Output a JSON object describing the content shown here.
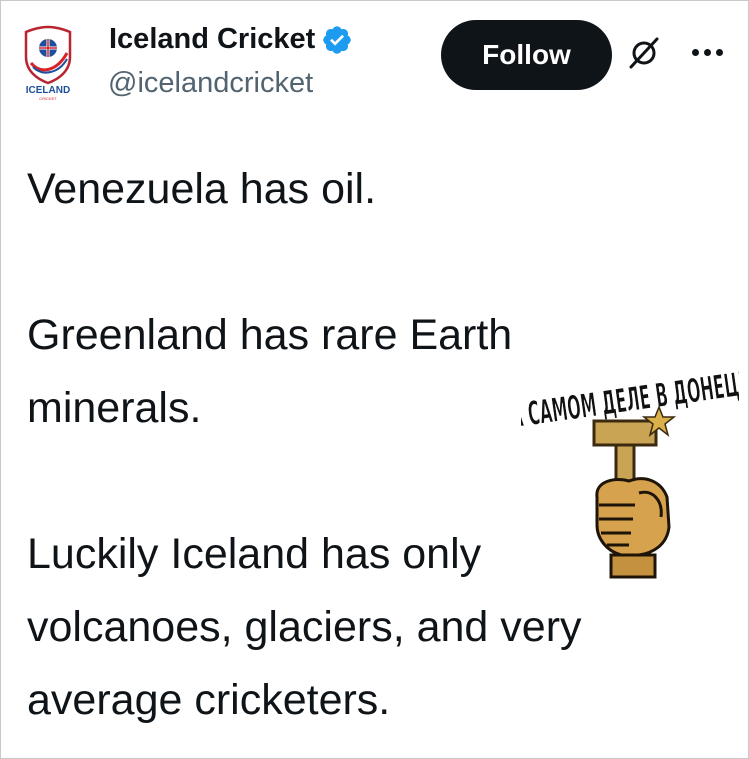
{
  "account": {
    "display_name": "Iceland Cricket",
    "handle": "@icelandcricket",
    "verified": true,
    "avatar_text": "ICELAND",
    "avatar_subtext": "CRICKET"
  },
  "actions": {
    "follow_label": "Follow",
    "grok_icon": "grok-icon",
    "more_icon": "more-options-icon"
  },
  "tweet": {
    "paragraphs": [
      [
        "Venezuela has oil."
      ],
      [
        "Greenland has rare Earth",
        "minerals."
      ],
      [
        "Luckily Iceland has only",
        "volcanoes, glaciers, and very",
        "average cricketers."
      ]
    ]
  },
  "sticker": {
    "caption": "НА САМОМ ДЕЛЕ В ДОНЕЦКЕ",
    "description_icon": "hammer-fist-icon"
  },
  "colors": {
    "text": "#0f1419",
    "muted": "#536471",
    "verified": "#1d9bf0",
    "follow_bg": "#0f1419"
  }
}
